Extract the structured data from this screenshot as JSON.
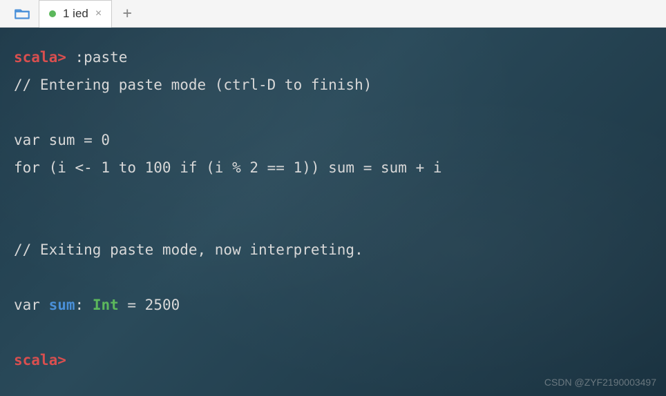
{
  "tabs": {
    "file_label": "1 ied"
  },
  "terminal": {
    "prompt": "scala>",
    "cmd_paste": ":paste",
    "enter_msg": "// Entering paste mode (ctrl-D to finish)",
    "code_line1": "var sum = 0",
    "code_line2": "for (i <- 1 to 100 if (i % 2 == 1)) sum = sum + i",
    "exit_msg": "// Exiting paste mode, now interpreting.",
    "result_prefix": "var ",
    "result_var": "sum",
    "result_colon": ": ",
    "result_type": "Int",
    "result_eq": " = 2500"
  },
  "watermark": "CSDN @ZYF2190003497"
}
